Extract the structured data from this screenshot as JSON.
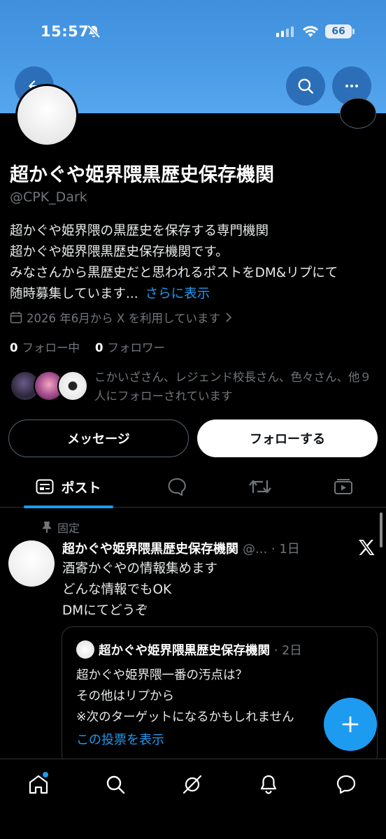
{
  "status_bar": {
    "time": "15:57",
    "battery": "66"
  },
  "header": {
    "back_icon": "arrow-left-icon",
    "search_icon": "search-icon",
    "more_icon": "more-horizontal-icon",
    "banner_color": "#4a9be6"
  },
  "profile": {
    "name": "超かぐや姫界隈黒歴史保存機関",
    "handle": "@CPK_Dark",
    "bio_lines": [
      "超かぐや姫界隈の黒歴史を保存する専門機関",
      "超かぐや姫界隈黒歴史保存機関です。",
      "みなさんから黒歴史だと思われるポストをDM&リプにて",
      "随時募集しています..."
    ],
    "bio_more": "さらに表示",
    "joined": "2026 年6月から X を利用しています",
    "following_count": "0",
    "following_label": "フォロー中",
    "followers_count": "0",
    "followers_label": "フォロワー",
    "known_followers_text": "こかいざさん、レジェンド校長さん、色々さん、他９人にフォローされています"
  },
  "actions": {
    "message": "メッセージ",
    "follow": "フォローする"
  },
  "tabs": {
    "posts": "ポスト"
  },
  "pinned_post": {
    "pinned_label": "固定",
    "author": "超かぐや姫界隈黒歴史保存機関",
    "meta": "@... · 1日",
    "lines": [
      "酒寄かぐやの情報集めます",
      "どんな情報でもOK",
      "DMにてどうぞ"
    ],
    "quote": {
      "author": "超かぐや姫界隈黒歴史保存機関",
      "meta": "· 2日",
      "lines": [
        "超かぐや姫界隈一番の汚点は？",
        "その他はリプから",
        "※次のターゲットになるかもしれません"
      ],
      "link": "この投票を表示"
    }
  },
  "colors": {
    "accent": "#1d9bf0",
    "background": "#000000",
    "muted": "#71767b"
  }
}
